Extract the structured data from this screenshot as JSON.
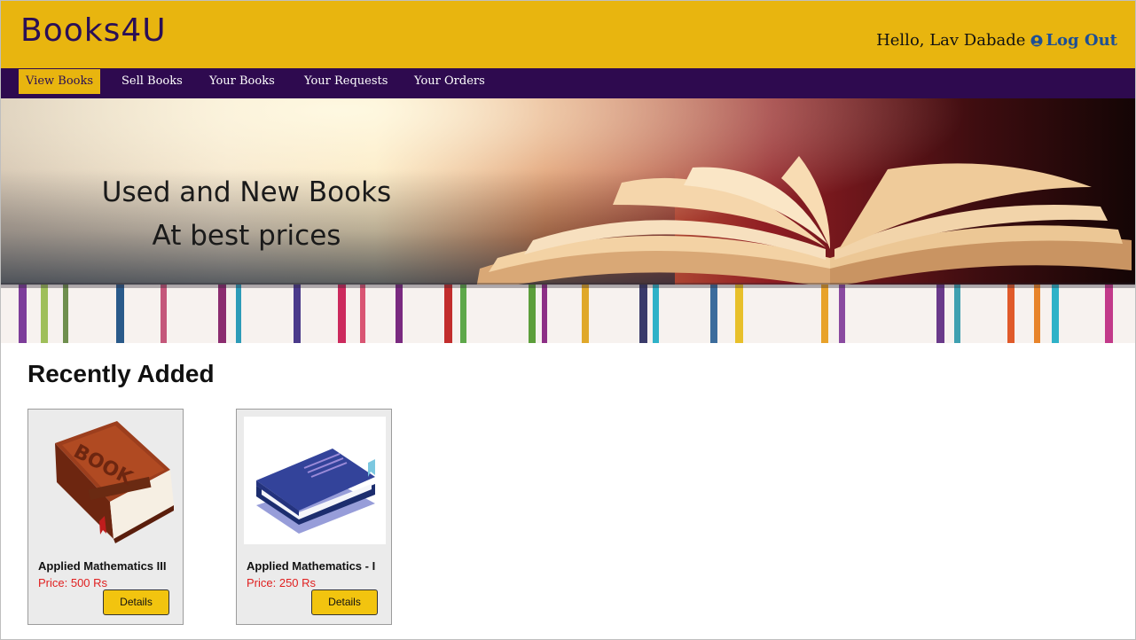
{
  "brand": {
    "logo": "Books4U"
  },
  "user": {
    "greeting": "Hello, Lav Dabade",
    "logout_label": "Log Out"
  },
  "nav": {
    "items": [
      {
        "label": "View Books",
        "active": true
      },
      {
        "label": "Sell Books",
        "active": false
      },
      {
        "label": "Your Books",
        "active": false
      },
      {
        "label": "Your Requests",
        "active": false
      },
      {
        "label": "Your Orders",
        "active": false
      }
    ]
  },
  "banner": {
    "line1": "Used and New Books",
    "line2": "At best prices"
  },
  "recent": {
    "title": "Recently Added",
    "books": [
      {
        "title": "Applied Mathematics III",
        "price": "Price: 500 Rs",
        "details_label": "Details",
        "image": "brown-book-icon"
      },
      {
        "title": "Applied Mathematics - I",
        "price": "Price: 250 Rs",
        "details_label": "Details",
        "image": "blue-book-icon"
      }
    ]
  },
  "colors": {
    "header": "#e8b50f",
    "nav": "#2e0a4f",
    "logo": "#2a0f56",
    "price": "#e02020",
    "button": "#f2c40f",
    "logout": "#1d4f95"
  }
}
